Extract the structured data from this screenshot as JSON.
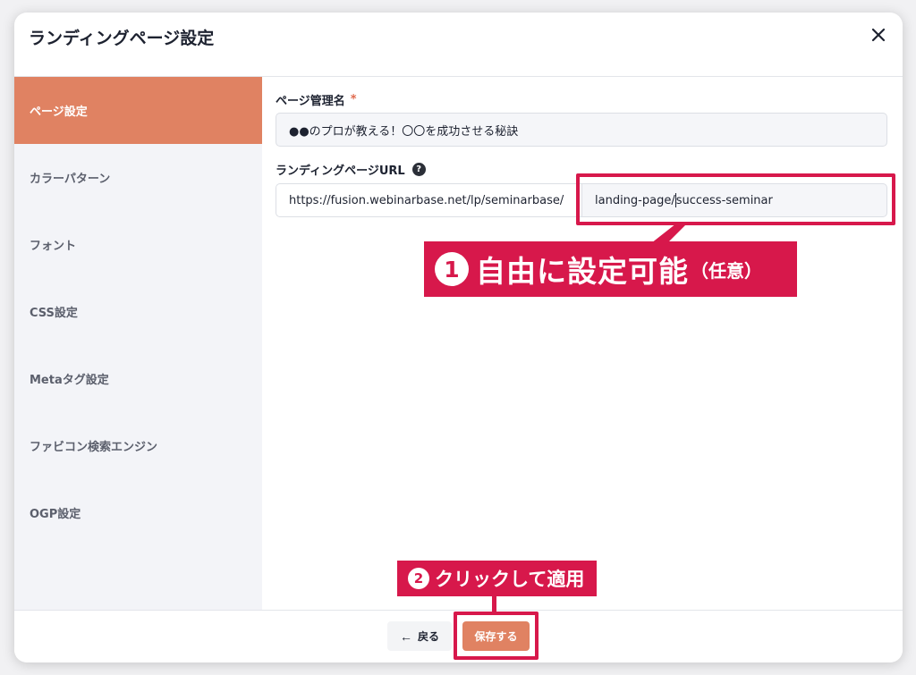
{
  "modal": {
    "title": "ランディングページ設定"
  },
  "sidebar": {
    "items": [
      {
        "label": "ページ設定",
        "active": true
      },
      {
        "label": "カラーパターン",
        "active": false
      },
      {
        "label": "フォント",
        "active": false
      },
      {
        "label": "CSS設定",
        "active": false
      },
      {
        "label": "Metaタグ設定",
        "active": false
      },
      {
        "label": "ファビコン検索エンジン",
        "active": false
      },
      {
        "label": "OGP設定",
        "active": false
      }
    ]
  },
  "form": {
    "page_name": {
      "label": "ページ管理名",
      "required_mark": "*",
      "value": "●●のプロが教える！〇〇を成功させる秘訣"
    },
    "lp_url": {
      "label": "ランディングページURL",
      "help_glyph": "?",
      "prefix": "https://fusion.webinarbase.net/lp/seminarbase/",
      "slug_before_caret": "landing-page/",
      "slug_after_caret": "success-seminar"
    }
  },
  "footer": {
    "back_arrow": "←",
    "back_label": "戻る",
    "save_label": "保存する"
  },
  "annotations": {
    "callout1": {
      "number": "1",
      "text": "自由に設定可能",
      "small": "（任意）"
    },
    "callout2": {
      "number": "2",
      "text": "クリックして適用"
    },
    "color": "#d7184b"
  },
  "colors": {
    "accent": "#e08262",
    "sidebar_bg": "#f3f4f8"
  },
  "icons": {
    "close": "close-icon",
    "help": "question-circle-icon",
    "back": "arrow-left-icon"
  }
}
